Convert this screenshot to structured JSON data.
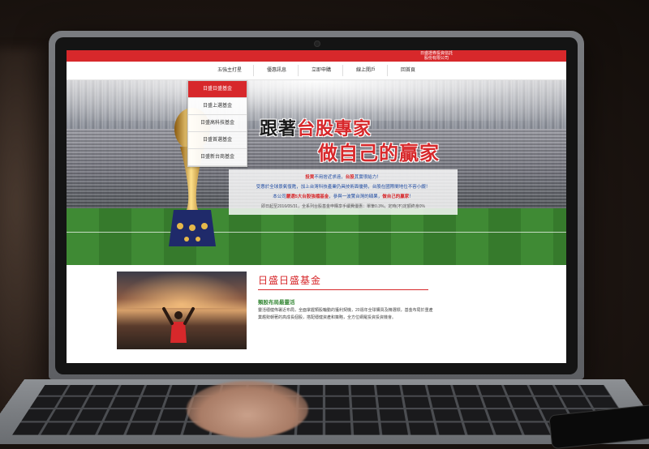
{
  "site": {
    "brand_line1": "日盛證券投資信託",
    "brand_line2": "股份有限公司",
    "accent_color": "#d7282b"
  },
  "nav": {
    "items": [
      "五強主打星",
      "優惠訊息",
      "立即申購",
      "線上開戶",
      "回首頁"
    ]
  },
  "dropdown": {
    "items": [
      "日盛日盛基金",
      "日盛上選基金",
      "日盛高科技基金",
      "日盛首選基金",
      "日盛新台商基金"
    ]
  },
  "hero": {
    "headline_pre": "跟著",
    "headline_red": "台股專家",
    "headline2": "做自己的贏家",
    "line1_a": "投資",
    "line1_b": "不用捨近求遠，",
    "line1_c": "台股",
    "line1_d": "其實很給力！",
    "line2": "受惠於全球景氣復甦，加上台灣科技產業仍具技術面優勢，台股在國際間地位不容小覷！",
    "line3_a": "本公司",
    "line3_b": "嚴選5大台股強檔基金",
    "line3_c": "，參與一波驚台灣的碩果，",
    "line3_d": "做自己的贏家",
    "line3_e": "！",
    "note": "即日起至2016/05/31，全系列台股基金申購享手續費優惠：單筆0.3%，定時(不)定額終身0%"
  },
  "feature": {
    "title": "日盛日盛基金",
    "subtitle": "類股布局最靈活",
    "body": "靈活穩健佈署近布局，全面掌握類股輪動的獲利契機，20週年全球購買及精選標，基金布局於重產業趨勢朝著的高成長個股，搭配穩健資產和策略，全方位網羅投資投資機會。"
  }
}
